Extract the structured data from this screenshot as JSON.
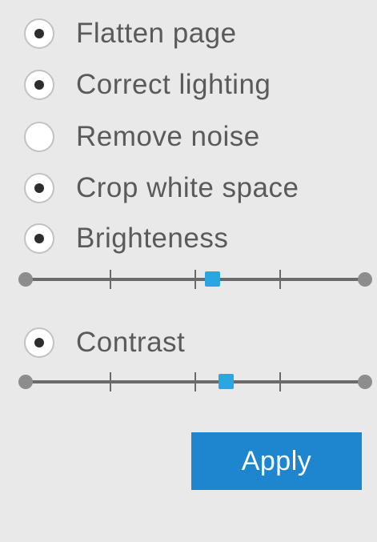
{
  "options": [
    {
      "label": "Flatten page",
      "checked": true
    },
    {
      "label": "Correct lighting",
      "checked": true
    },
    {
      "label": "Remove noise",
      "checked": false
    },
    {
      "label": "Crop white space",
      "checked": true
    },
    {
      "label": "Brighteness",
      "checked": true
    },
    {
      "label": "Contrast",
      "checked": true
    }
  ],
  "sliders": {
    "brightness": {
      "value": 0.55,
      "ticks": 4,
      "tick_positions": [
        0.25,
        0.5,
        0.75
      ]
    },
    "contrast": {
      "value": 0.59,
      "ticks": 4,
      "tick_positions": [
        0.25,
        0.5,
        0.75
      ]
    }
  },
  "apply_button": {
    "label": "Apply"
  },
  "colors": {
    "accent": "#1e86cf",
    "slider_thumb": "#2aa6e0",
    "background": "#e9e9e9"
  }
}
